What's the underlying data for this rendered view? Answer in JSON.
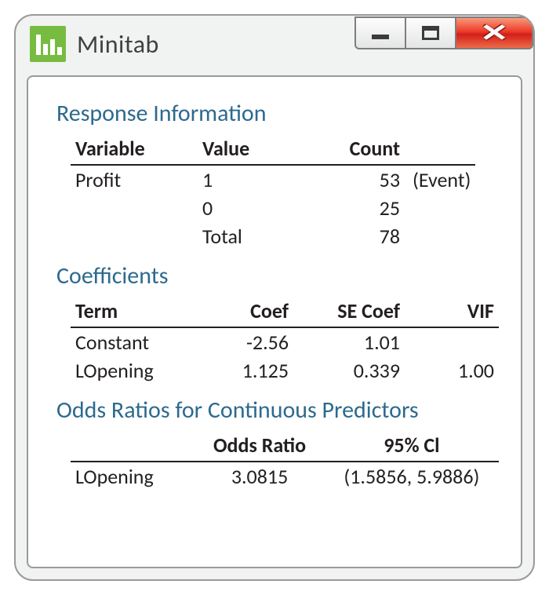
{
  "app": {
    "title": "Minitab",
    "icon_name": "bar-chart-icon"
  },
  "window_controls": {
    "minimize": "Minimize",
    "maximize": "Maximize",
    "close": "Close"
  },
  "sections": {
    "response": {
      "title": "Response Information",
      "headers": {
        "variable": "Variable",
        "value": "Value",
        "count": "Count"
      },
      "rows": [
        {
          "variable": "Profit",
          "value": "1",
          "count": "53",
          "note": "(Event)"
        },
        {
          "variable": "",
          "value": "0",
          "count": "25",
          "note": ""
        },
        {
          "variable": "",
          "value": "Total",
          "count": "78",
          "note": ""
        }
      ]
    },
    "coefficients": {
      "title": "Coefficients",
      "headers": {
        "term": "Term",
        "coef": "Coef",
        "se": "SE Coef",
        "vif": "VIF"
      },
      "rows": [
        {
          "term": "Constant",
          "coef": "-2.56",
          "se": "1.01",
          "vif": ""
        },
        {
          "term": "LOpening",
          "coef": "1.125",
          "se": "0.339",
          "vif": "1.00"
        }
      ]
    },
    "odds": {
      "title": "Odds Ratios for Continuous Predictors",
      "headers": {
        "term": "",
        "ratio": "Odds Ratio",
        "ci": "95% Cl"
      },
      "rows": [
        {
          "term": "LOpening",
          "ratio": "3.0815",
          "ci": "(1.5856, 5.9886)"
        }
      ]
    }
  }
}
